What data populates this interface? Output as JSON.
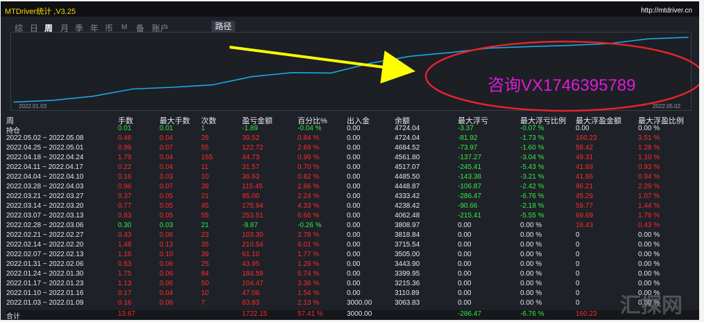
{
  "window": {
    "title": "MTDriver统计 ,V3.25",
    "url": "http://mtdriver.cn"
  },
  "tabs": [
    {
      "label": "综",
      "active": false
    },
    {
      "label": "日",
      "active": false
    },
    {
      "label": "周",
      "active": true
    },
    {
      "label": "月",
      "active": false
    },
    {
      "label": "季",
      "active": false
    },
    {
      "label": "年",
      "active": false
    },
    {
      "label": "币",
      "active": false
    },
    {
      "label": "M",
      "active": false
    },
    {
      "label": "备",
      "active": false
    },
    {
      "label": "账户",
      "active": false
    }
  ],
  "path_button": "路径",
  "chart_data": {
    "type": "line",
    "x_start_label": "2022.01.03",
    "x_end_label": "2022.05.02",
    "x": [
      "2022.01.03",
      "2022.01.10",
      "2022.01.17",
      "2022.01.24",
      "2022.01.31",
      "2022.02.07",
      "2022.02.14",
      "2022.02.21",
      "2022.02.28",
      "2022.03.07",
      "2022.03.14",
      "2022.03.21",
      "2022.03.28",
      "2022.04.04",
      "2022.04.11",
      "2022.04.18",
      "2022.04.25",
      "2022.05.02"
    ],
    "y": [
      3063.83,
      3110.89,
      3215.36,
      3399.95,
      3443.9,
      3505.0,
      3715.54,
      3818.84,
      3808.97,
      4062.48,
      4238.42,
      4333.42,
      4448.87,
      4485.5,
      4517.07,
      4561.8,
      4684.52,
      4724.04
    ],
    "line_color": "#1ca8e8"
  },
  "annotation": {
    "consult_text": "咨询VX1746395789",
    "arrow_color": "#ffff00",
    "ellipse_color": "#e5232d"
  },
  "table": {
    "headers": [
      "周",
      "手数",
      "最大手数",
      "次数",
      "盈亏金额",
      "百分比%",
      "出入金",
      "余额",
      "最大浮亏",
      "最大浮亏比例",
      "最大浮盈金额",
      "最大浮盈比例"
    ],
    "position_row": [
      "持仓",
      "0.01",
      "0.01",
      "1",
      "-1.89",
      "-0.04 %",
      "0.00",
      "4724.04",
      "-3.37",
      "-0.07 %",
      "0.00",
      "0.00 %"
    ],
    "rows": [
      [
        "2022.05.02 ~ 2022.05.08",
        "0.46",
        "0.04",
        "28",
        "39.52",
        "0.84 %",
        "0.00",
        "4724.04",
        "-81.92",
        "-1.73 %",
        "160.23",
        "3.51 %"
      ],
      [
        "2022.04.25 ~ 2022.05.01",
        "0.99",
        "0.07",
        "55",
        "122.72",
        "2.69 %",
        "0.00",
        "4684.52",
        "-73.97",
        "-1.60 %",
        "58.42",
        "1.28 %"
      ],
      [
        "2022.04.18 ~ 2022.04.24",
        "1.79",
        "0.04",
        "155",
        "44.73",
        "0.99 %",
        "0.00",
        "4561.80",
        "-137.27",
        "-3.04 %",
        "49.31",
        "1.10 %"
      ],
      [
        "2022.04.11 ~ 2022.04.17",
        "0.22",
        "0.04",
        "11",
        "31.57",
        "0.70 %",
        "0.00",
        "4517.07",
        "-245.41",
        "-5.43 %",
        "41.69",
        "0.93 %"
      ],
      [
        "2022.04.04 ~ 2022.04.10",
        "0.16",
        "0.03",
        "10",
        "36.63",
        "0.82 %",
        "0.00",
        "4485.50",
        "-143.38",
        "-3.21 %",
        "41.86",
        "0.94 %"
      ],
      [
        "2022.03.28 ~ 2022.04.03",
        "0.96",
        "0.07",
        "39",
        "115.45",
        "2.66 %",
        "0.00",
        "4448.87",
        "-106.87",
        "-2.42 %",
        "96.21",
        "2.29 %"
      ],
      [
        "2022.03.21 ~ 2022.03.27",
        "0.37",
        "0.05",
        "21",
        "95.00",
        "2.24 %",
        "0.00",
        "4333.42",
        "-286.47",
        "-6.76 %",
        "45.29",
        "1.07 %"
      ],
      [
        "2022.03.14 ~ 2022.03.20",
        "0.77",
        "0.05",
        "45",
        "175.94",
        "4.33 %",
        "0.00",
        "4238.42",
        "-90.66",
        "-2.18 %",
        "59.77",
        "1.44 %"
      ],
      [
        "2022.03.07 ~ 2022.03.13",
        "0.83",
        "0.05",
        "55",
        "253.51",
        "6.66 %",
        "0.00",
        "4062.48",
        "-215.41",
        "-5.55 %",
        "69.69",
        "1.79 %"
      ],
      [
        "2022.02.28 ~ 2022.03.06",
        "0.30",
        "0.03",
        "21",
        "-9.87",
        "-0.26 %",
        "0.00",
        "3808.97",
        "0.00",
        "0.00 %",
        "16.43",
        "0.43 %"
      ],
      [
        "2022.02.21 ~ 2022.02.27",
        "0.43",
        "0.06",
        "23",
        "103.30",
        "2.78 %",
        "0.00",
        "3818.84",
        "0.00",
        "0.00 %",
        "0",
        "0.00 %"
      ],
      [
        "2022.02.14 ~ 2022.02.20",
        "1.48",
        "0.13",
        "35",
        "210.54",
        "6.01 %",
        "0.00",
        "3715.54",
        "0.00",
        "0.00 %",
        "0",
        "0.00 %"
      ],
      [
        "2022.02.07 ~ 2022.02.13",
        "1.16",
        "0.10",
        "39",
        "61.10",
        "1.77 %",
        "0.00",
        "3505.00",
        "0.00",
        "0.00 %",
        "0",
        "0.00 %"
      ],
      [
        "2022.01.31 ~ 2022.02.06",
        "0.53",
        "0.06",
        "25",
        "43.95",
        "1.29 %",
        "0.00",
        "3443.90",
        "0.00",
        "0.00 %",
        "0",
        "0.00 %"
      ],
      [
        "2022.01.24 ~ 2022.01.30",
        "1.75",
        "0.06",
        "84",
        "184.59",
        "5.74 %",
        "0.00",
        "3399.95",
        "0.00",
        "0.00 %",
        "0",
        "0.00 %"
      ],
      [
        "2022.01.17 ~ 2022.01.23",
        "1.13",
        "0.06",
        "50",
        "104.47",
        "3.36 %",
        "0.00",
        "3215.36",
        "0.00",
        "0.00 %",
        "0",
        "0.00 %"
      ],
      [
        "2022.01.10 ~ 2022.01.16",
        "0.17",
        "0.04",
        "10",
        "47.06",
        "1.54 %",
        "0.00",
        "3110.89",
        "0.00",
        "0.00 %",
        "0",
        "0.00 %"
      ],
      [
        "2022.01.03 ~ 2022.01.09",
        "0.16",
        "0.06",
        "7",
        "63.83",
        "2.13 %",
        "3000.00",
        "3063.83",
        "0.00",
        "0.00 %",
        "0",
        "0.00 %"
      ]
    ],
    "total_row": [
      "合计",
      "13.67",
      "",
      "",
      "1722.15",
      "57.41 %",
      "3000.00",
      "",
      "-286.47",
      "-6.76 %",
      "160.23",
      ""
    ]
  },
  "watermark": "汇探网",
  "colors": {
    "loss": "#ff2a2a",
    "gain": "#33ee44",
    "text": "#e5e8ee",
    "title": "#ffd900"
  }
}
